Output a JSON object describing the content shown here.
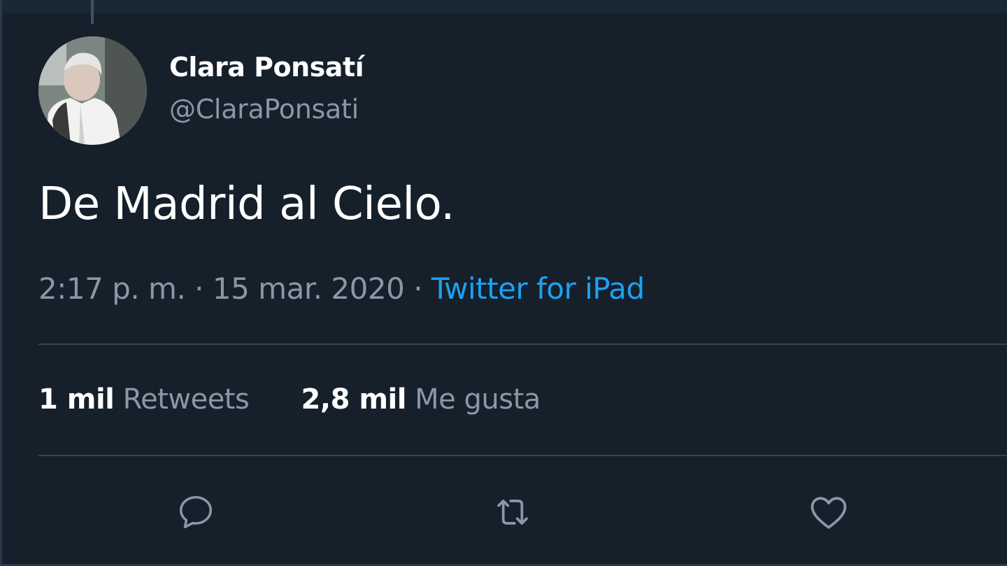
{
  "tweet": {
    "author": {
      "display_name": "Clara Ponsatí",
      "username": "@ClaraPonsati"
    },
    "text": "De Madrid al Cielo.",
    "meta": {
      "time": "2:17 p. m.",
      "separator": "·",
      "date": "15 mar. 2020",
      "source": "Twitter for iPad"
    },
    "stats": {
      "retweets": {
        "count": "1 mil",
        "label": "Retweets"
      },
      "likes": {
        "count": "2,8 mil",
        "label": "Me gusta"
      }
    },
    "actions": [
      {
        "name": "reply",
        "icon": "reply-icon"
      },
      {
        "name": "retweet",
        "icon": "retweet-icon"
      },
      {
        "name": "like",
        "icon": "heart-icon"
      }
    ]
  },
  "colors": {
    "background": "#15202b",
    "primary_text": "#ffffff",
    "secondary_text": "#8899a6",
    "accent": "#1da1f2",
    "divider": "#38444d"
  }
}
